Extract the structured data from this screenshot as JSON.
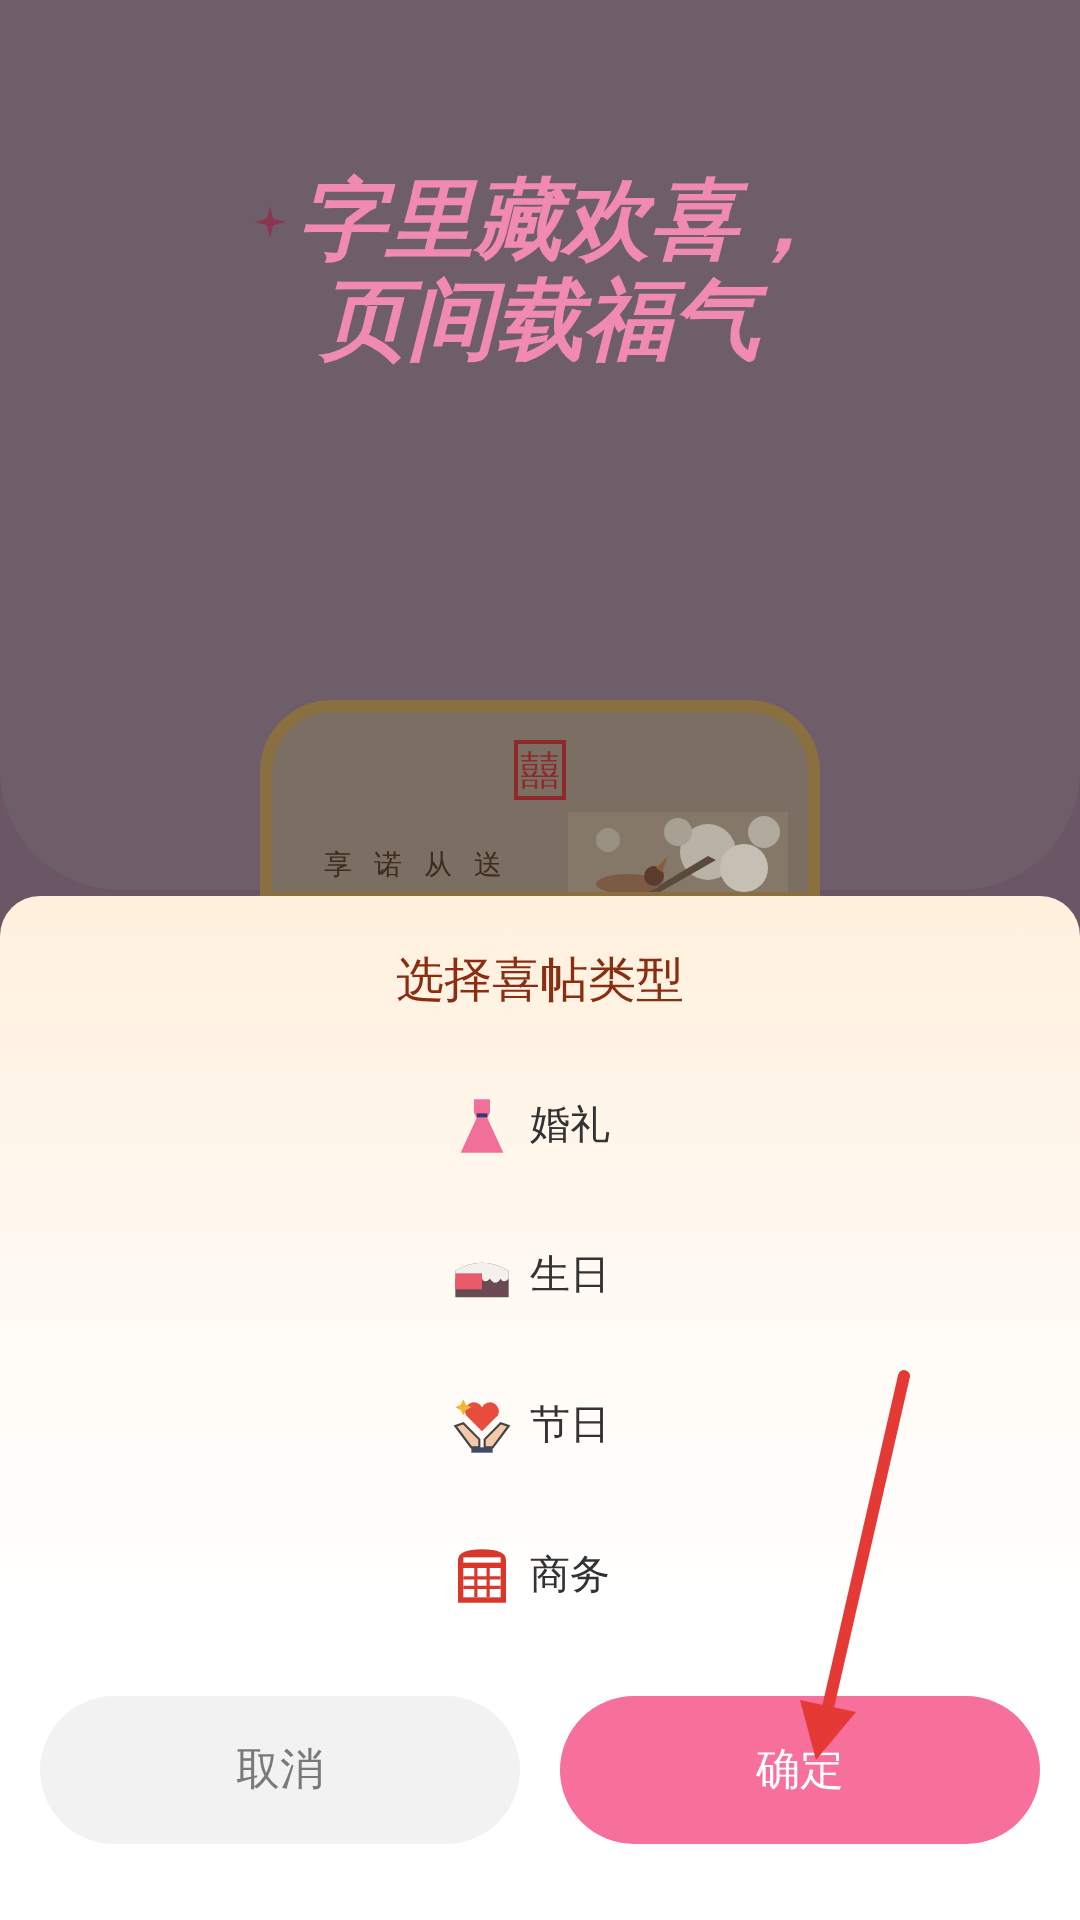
{
  "background": {
    "headline_lines": [
      "字里藏欢喜，",
      "页间载福气"
    ],
    "card": {
      "seal": "囍",
      "columns": [
        "享",
        "诺",
        "从",
        "送"
      ]
    }
  },
  "dialog": {
    "title": "选择喜帖类型",
    "options": [
      {
        "kind": "wedding",
        "label": "婚礼"
      },
      {
        "kind": "birthday",
        "label": "生日"
      },
      {
        "kind": "holiday",
        "label": "节日"
      },
      {
        "kind": "business",
        "label": "商务"
      }
    ],
    "buttons": [
      {
        "kind": "cancel",
        "label": "取消"
      },
      {
        "kind": "confirm",
        "label": "确定"
      }
    ]
  }
}
